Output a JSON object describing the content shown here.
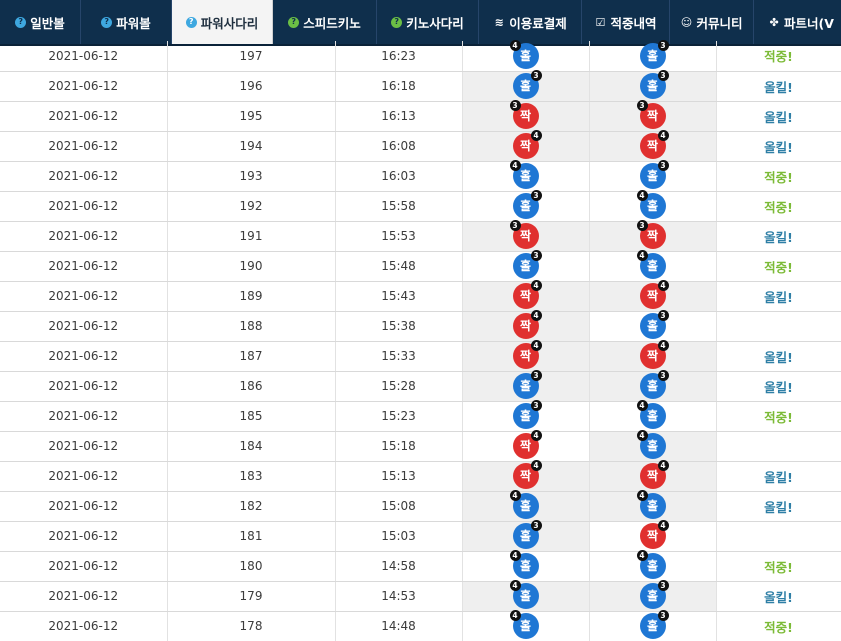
{
  "nav": {
    "items": [
      {
        "label": "일반볼",
        "icon": "question-circle-icon",
        "glyph": "?",
        "style": "q",
        "active": false,
        "width": 81
      },
      {
        "label": "파워볼",
        "icon": "question-circle-icon",
        "glyph": "?",
        "style": "q",
        "active": false,
        "width": 91
      },
      {
        "label": "파워사다리",
        "icon": "question-circle-icon",
        "glyph": "?",
        "style": "q",
        "active": true,
        "width": 101
      },
      {
        "label": "스피드키노",
        "icon": "question-circle-green-icon",
        "glyph": "?",
        "style": "q-green",
        "active": false,
        "width": 104
      },
      {
        "label": "키노사다리",
        "icon": "question-circle-green-icon",
        "glyph": "?",
        "style": "q-green",
        "active": false,
        "width": 102
      },
      {
        "label": "이용료결제",
        "icon": "database-icon",
        "glyph": "≋",
        "style": "glyph",
        "active": false,
        "width": 103
      },
      {
        "label": "적중내역",
        "icon": "check-square-icon",
        "glyph": "☑",
        "style": "glyph",
        "active": false,
        "width": 88
      },
      {
        "label": "커뮤니티",
        "icon": "smile-icon",
        "glyph": "☺",
        "style": "glyph",
        "active": false,
        "width": 84
      },
      {
        "label": "파트너(V",
        "icon": "cubes-icon",
        "glyph": "✤",
        "style": "glyph",
        "active": false,
        "width": 95
      }
    ]
  },
  "colors": {
    "nav_bg": "#0f2f4c",
    "odd_ball": "#1f77d4",
    "even_ball": "#e0302f",
    "hit_text": "#7cbb37",
    "miss_text": "#2f7fa6"
  },
  "rows": [
    {
      "date": "2021-06-12",
      "round": "197",
      "time": "16:23",
      "r1": {
        "label": "홀",
        "type": "odd",
        "badge": "4",
        "pos": "left"
      },
      "r2": {
        "label": "홀",
        "type": "odd",
        "badge": "3",
        "pos": "right"
      },
      "shade1": false,
      "shade2": false,
      "outcome": "적중!",
      "outcome_type": "hit"
    },
    {
      "date": "2021-06-12",
      "round": "196",
      "time": "16:18",
      "r1": {
        "label": "홀",
        "type": "odd",
        "badge": "3",
        "pos": "right"
      },
      "r2": {
        "label": "홀",
        "type": "odd",
        "badge": "3",
        "pos": "right"
      },
      "shade1": true,
      "shade2": true,
      "outcome": "올킬!",
      "outcome_type": "miss"
    },
    {
      "date": "2021-06-12",
      "round": "195",
      "time": "16:13",
      "r1": {
        "label": "짝",
        "type": "even",
        "badge": "3",
        "pos": "left"
      },
      "r2": {
        "label": "짝",
        "type": "even",
        "badge": "3",
        "pos": "left"
      },
      "shade1": true,
      "shade2": true,
      "outcome": "올킬!",
      "outcome_type": "miss"
    },
    {
      "date": "2021-06-12",
      "round": "194",
      "time": "16:08",
      "r1": {
        "label": "짝",
        "type": "even",
        "badge": "4",
        "pos": "right"
      },
      "r2": {
        "label": "짝",
        "type": "even",
        "badge": "4",
        "pos": "right"
      },
      "shade1": true,
      "shade2": true,
      "outcome": "올킬!",
      "outcome_type": "miss"
    },
    {
      "date": "2021-06-12",
      "round": "193",
      "time": "16:03",
      "r1": {
        "label": "홀",
        "type": "odd",
        "badge": "4",
        "pos": "left"
      },
      "r2": {
        "label": "홀",
        "type": "odd",
        "badge": "3",
        "pos": "right"
      },
      "shade1": false,
      "shade2": false,
      "outcome": "적중!",
      "outcome_type": "hit"
    },
    {
      "date": "2021-06-12",
      "round": "192",
      "time": "15:58",
      "r1": {
        "label": "홀",
        "type": "odd",
        "badge": "3",
        "pos": "right"
      },
      "r2": {
        "label": "홀",
        "type": "odd",
        "badge": "4",
        "pos": "left"
      },
      "shade1": false,
      "shade2": false,
      "outcome": "적중!",
      "outcome_type": "hit"
    },
    {
      "date": "2021-06-12",
      "round": "191",
      "time": "15:53",
      "r1": {
        "label": "짝",
        "type": "even",
        "badge": "3",
        "pos": "left"
      },
      "r2": {
        "label": "짝",
        "type": "even",
        "badge": "3",
        "pos": "left"
      },
      "shade1": true,
      "shade2": true,
      "outcome": "올킬!",
      "outcome_type": "miss"
    },
    {
      "date": "2021-06-12",
      "round": "190",
      "time": "15:48",
      "r1": {
        "label": "홀",
        "type": "odd",
        "badge": "3",
        "pos": "right"
      },
      "r2": {
        "label": "홀",
        "type": "odd",
        "badge": "4",
        "pos": "left"
      },
      "shade1": false,
      "shade2": false,
      "outcome": "적중!",
      "outcome_type": "hit"
    },
    {
      "date": "2021-06-12",
      "round": "189",
      "time": "15:43",
      "r1": {
        "label": "짝",
        "type": "even",
        "badge": "4",
        "pos": "right"
      },
      "r2": {
        "label": "짝",
        "type": "even",
        "badge": "4",
        "pos": "right"
      },
      "shade1": true,
      "shade2": true,
      "outcome": "올킬!",
      "outcome_type": "miss"
    },
    {
      "date": "2021-06-12",
      "round": "188",
      "time": "15:38",
      "r1": {
        "label": "짝",
        "type": "even",
        "badge": "4",
        "pos": "right"
      },
      "r2": {
        "label": "홀",
        "type": "odd",
        "badge": "3",
        "pos": "right"
      },
      "shade1": true,
      "shade2": false,
      "outcome": "",
      "outcome_type": "none"
    },
    {
      "date": "2021-06-12",
      "round": "187",
      "time": "15:33",
      "r1": {
        "label": "짝",
        "type": "even",
        "badge": "4",
        "pos": "right"
      },
      "r2": {
        "label": "짝",
        "type": "even",
        "badge": "4",
        "pos": "right"
      },
      "shade1": true,
      "shade2": true,
      "outcome": "올킬!",
      "outcome_type": "miss"
    },
    {
      "date": "2021-06-12",
      "round": "186",
      "time": "15:28",
      "r1": {
        "label": "홀",
        "type": "odd",
        "badge": "3",
        "pos": "right"
      },
      "r2": {
        "label": "홀",
        "type": "odd",
        "badge": "3",
        "pos": "right"
      },
      "shade1": true,
      "shade2": true,
      "outcome": "올킬!",
      "outcome_type": "miss"
    },
    {
      "date": "2021-06-12",
      "round": "185",
      "time": "15:23",
      "r1": {
        "label": "홀",
        "type": "odd",
        "badge": "3",
        "pos": "right"
      },
      "r2": {
        "label": "홀",
        "type": "odd",
        "badge": "4",
        "pos": "left"
      },
      "shade1": false,
      "shade2": false,
      "outcome": "적중!",
      "outcome_type": "hit"
    },
    {
      "date": "2021-06-12",
      "round": "184",
      "time": "15:18",
      "r1": {
        "label": "짝",
        "type": "even",
        "badge": "4",
        "pos": "right"
      },
      "r2": {
        "label": "홀",
        "type": "odd",
        "badge": "4",
        "pos": "left"
      },
      "shade1": false,
      "shade2": true,
      "outcome": "",
      "outcome_type": "none"
    },
    {
      "date": "2021-06-12",
      "round": "183",
      "time": "15:13",
      "r1": {
        "label": "짝",
        "type": "even",
        "badge": "4",
        "pos": "right"
      },
      "r2": {
        "label": "짝",
        "type": "even",
        "badge": "4",
        "pos": "right"
      },
      "shade1": true,
      "shade2": true,
      "outcome": "올킬!",
      "outcome_type": "miss"
    },
    {
      "date": "2021-06-12",
      "round": "182",
      "time": "15:08",
      "r1": {
        "label": "홀",
        "type": "odd",
        "badge": "4",
        "pos": "left"
      },
      "r2": {
        "label": "홀",
        "type": "odd",
        "badge": "4",
        "pos": "left"
      },
      "shade1": true,
      "shade2": true,
      "outcome": "올킬!",
      "outcome_type": "miss"
    },
    {
      "date": "2021-06-12",
      "round": "181",
      "time": "15:03",
      "r1": {
        "label": "홀",
        "type": "odd",
        "badge": "3",
        "pos": "right"
      },
      "r2": {
        "label": "짝",
        "type": "even",
        "badge": "4",
        "pos": "right"
      },
      "shade1": true,
      "shade2": false,
      "outcome": "",
      "outcome_type": "none"
    },
    {
      "date": "2021-06-12",
      "round": "180",
      "time": "14:58",
      "r1": {
        "label": "홀",
        "type": "odd",
        "badge": "4",
        "pos": "left"
      },
      "r2": {
        "label": "홀",
        "type": "odd",
        "badge": "4",
        "pos": "left"
      },
      "shade1": false,
      "shade2": false,
      "outcome": "적중!",
      "outcome_type": "hit"
    },
    {
      "date": "2021-06-12",
      "round": "179",
      "time": "14:53",
      "r1": {
        "label": "홀",
        "type": "odd",
        "badge": "4",
        "pos": "left"
      },
      "r2": {
        "label": "홀",
        "type": "odd",
        "badge": "3",
        "pos": "right"
      },
      "shade1": true,
      "shade2": true,
      "outcome": "올킬!",
      "outcome_type": "miss"
    },
    {
      "date": "2021-06-12",
      "round": "178",
      "time": "14:48",
      "r1": {
        "label": "홀",
        "type": "odd",
        "badge": "4",
        "pos": "left"
      },
      "r2": {
        "label": "홀",
        "type": "odd",
        "badge": "3",
        "pos": "right"
      },
      "shade1": false,
      "shade2": false,
      "outcome": "적중!",
      "outcome_type": "hit"
    }
  ]
}
